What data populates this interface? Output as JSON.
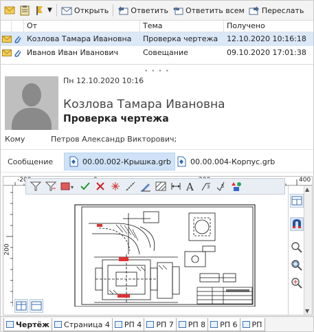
{
  "toolbar": {
    "open": "Открыть",
    "reply": "Ответить",
    "reply_all": "Ответить всем",
    "forward": "Переслать"
  },
  "list": {
    "columns": [
      "От",
      "Тема",
      "Получено"
    ],
    "rows": [
      {
        "from": "Козлова Тамара Ивановна",
        "subject": "Проверка чертежа",
        "received": "12.10.2020 10:16:18"
      },
      {
        "from": "Иванов Иван Иванович",
        "subject": "Совещание",
        "received": "09.10.2020 17:01:38"
      }
    ]
  },
  "message": {
    "date": "Пн 12.10.2020 10:16",
    "sender": "Козлова Тамара Ивановна",
    "subject": "Проверка чертежа",
    "to_label": "Кому",
    "to_value": "Петров Александр Викторович;",
    "attach_label": "Сообщение",
    "attachments": [
      "00.00.002-Крышка.grb",
      "00.00.004-Корпус.grb"
    ]
  },
  "viewer": {
    "ruler_top": [
      "-200",
      "0",
      "200",
      "400"
    ],
    "ruler_left": "200"
  },
  "tabs": [
    "Чертёж",
    "Страница 4",
    "РП 4",
    "РП 7",
    "РП 8",
    "РП 6",
    "РП"
  ],
  "colors": {
    "accent": "#2f6db3",
    "selection": "#dbe8f7",
    "mail": "#f0c24f"
  }
}
